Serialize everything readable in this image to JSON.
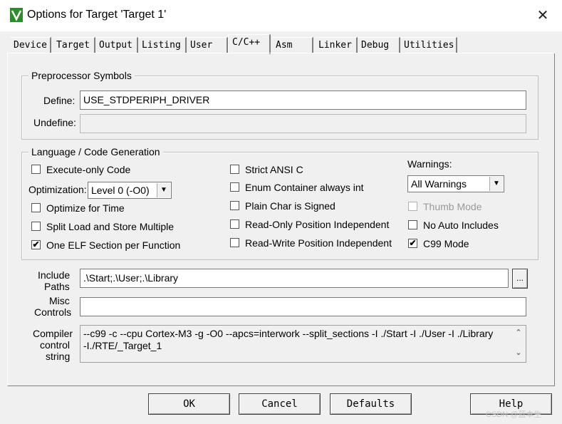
{
  "window": {
    "title": "Options for Target 'Target 1'",
    "close_label": "✕"
  },
  "tabs": [
    {
      "label": "Device"
    },
    {
      "label": "Target"
    },
    {
      "label": "Output"
    },
    {
      "label": "Listing"
    },
    {
      "label": "User"
    },
    {
      "label": "C/C++"
    },
    {
      "label": "Asm"
    },
    {
      "label": "Linker"
    },
    {
      "label": "Debug"
    },
    {
      "label": "Utilities"
    }
  ],
  "preprocessor": {
    "title": "Preprocessor Symbols",
    "define_label": "Define:",
    "define_value": "USE_STDPERIPH_DRIVER",
    "undefine_label": "Undefine:",
    "undefine_value": ""
  },
  "language": {
    "title": "Language / Code Generation",
    "execute_only": {
      "label": "Execute-only Code",
      "checked": ""
    },
    "optimization_label": "Optimization:",
    "optimization_value": "Level 0 (-O0)",
    "optimize_time": {
      "label": "Optimize for Time",
      "checked": ""
    },
    "split_load": {
      "label": "Split Load and Store Multiple",
      "checked": ""
    },
    "one_elf": {
      "label": "One ELF Section per Function",
      "checked": "✔"
    },
    "strict_ansi": {
      "label": "Strict ANSI C",
      "checked": ""
    },
    "enum_container": {
      "label": "Enum Container always int",
      "checked": ""
    },
    "plain_char": {
      "label": "Plain Char is Signed",
      "checked": ""
    },
    "ro_position": {
      "label": "Read-Only Position Independent",
      "checked": ""
    },
    "rw_position": {
      "label": "Read-Write Position Independent",
      "checked": ""
    },
    "warnings_label": "Warnings:",
    "warnings_value": "All Warnings",
    "thumb_mode": {
      "label": "Thumb Mode",
      "checked": ""
    },
    "no_auto_includes": {
      "label": "No Auto Includes",
      "checked": ""
    },
    "c99_mode": {
      "label": "C99 Mode",
      "checked": "✔"
    }
  },
  "include": {
    "label_line1": "Include",
    "label_line2": "Paths",
    "value": ".\\Start;.\\User;.\\Library",
    "browse_label": "..."
  },
  "misc": {
    "label_line1": "Misc",
    "label_line2": "Controls",
    "value": ""
  },
  "compiler": {
    "label_line1": "Compiler",
    "label_line2": "control",
    "label_line3": "string",
    "line1": "--c99 -c --cpu Cortex-M3 -g -O0 --apcs=interwork --split_sections -I ./Start -I ./User -I ./Library",
    "line2": "-I./RTE/_Target_1",
    "scroll_up": "⌃",
    "scroll_down": "⌄"
  },
  "buttons": {
    "ok": "OK",
    "cancel": "Cancel",
    "defaults": "Defaults",
    "help": "Help"
  },
  "watermark": "CSDN @蓝本生"
}
